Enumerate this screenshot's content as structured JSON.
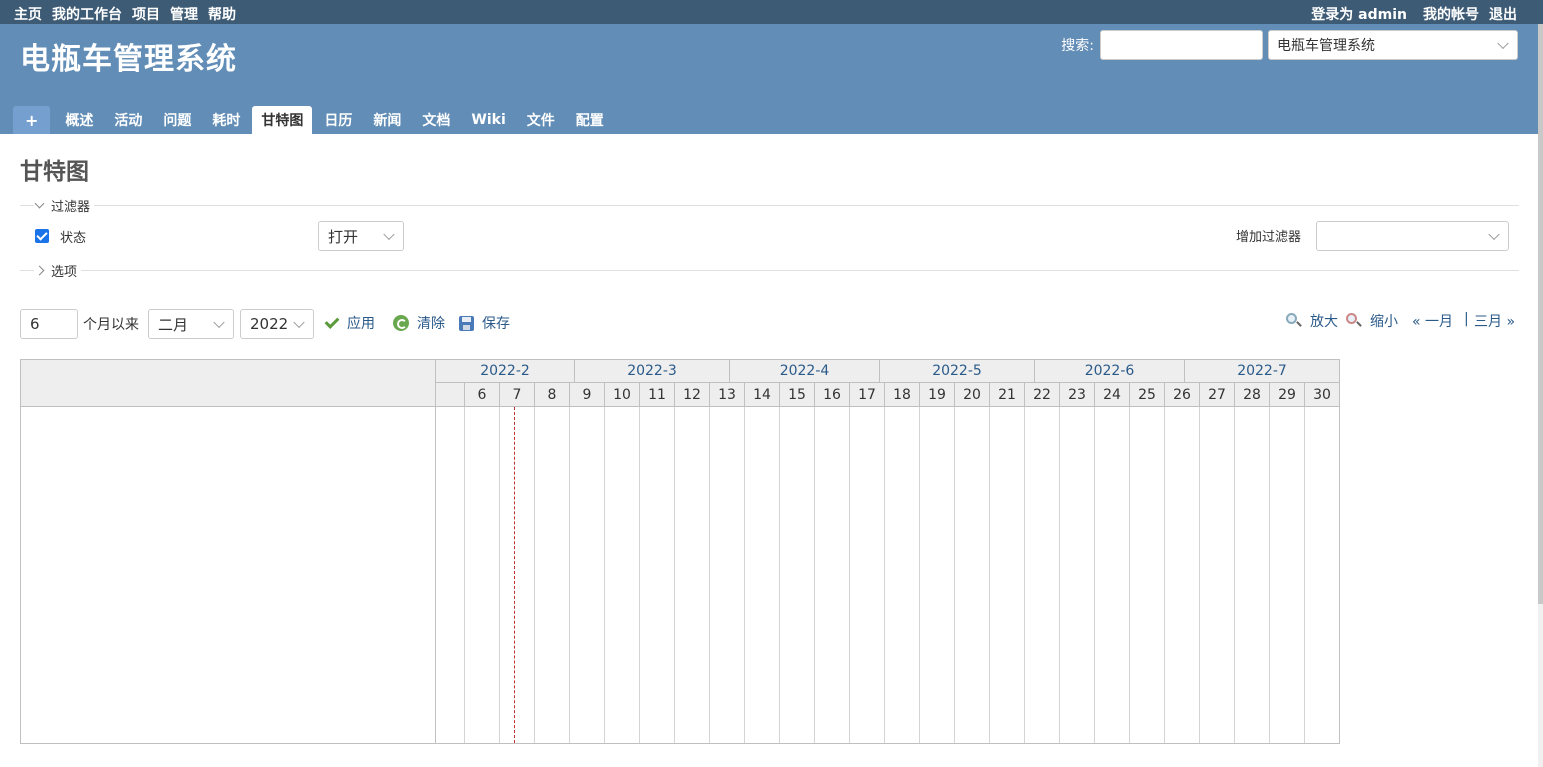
{
  "top_menu": {
    "items": [
      "主页",
      "我的工作台",
      "项目",
      "管理",
      "帮助"
    ],
    "login_prefix": "登录为",
    "login_user": "admin",
    "my_account": "我的帐号",
    "logout": "退出"
  },
  "header": {
    "title": "电瓶车管理系统",
    "search_label": "搜索:",
    "search_value": "",
    "project_select": "电瓶车管理系统"
  },
  "main_menu": {
    "new_label": "+",
    "tabs": [
      "概述",
      "活动",
      "问题",
      "耗时",
      "甘特图",
      "日历",
      "新闻",
      "文档",
      "Wiki",
      "文件",
      "配置"
    ],
    "selected": "甘特图"
  },
  "page": {
    "title": "甘特图",
    "filters_legend": "过滤器",
    "status_label": "状态",
    "status_operator": "打开",
    "add_filter_label": "增加过滤器",
    "add_filter_value": "",
    "options_legend": "选项"
  },
  "query": {
    "months": "6",
    "months_label": "个月以来",
    "month": "二月",
    "year": "2022",
    "apply": "应用",
    "clear": "清除",
    "save": "保存",
    "zoom_in": "放大",
    "zoom_out": "缩小",
    "prev": "« 一月",
    "separator": "|",
    "next": "三月 »"
  },
  "gantt": {
    "months": [
      {
        "label": "2022-2",
        "weeks": 4
      },
      {
        "label": "2022-3",
        "weeks": 4.5
      },
      {
        "label": "2022-4",
        "weeks": 4.3
      },
      {
        "label": "2022-5",
        "weeks": 4.4
      },
      {
        "label": "2022-6",
        "weeks": 4.3
      },
      {
        "label": "2022-7",
        "weeks": 4.4
      }
    ],
    "weeks": [
      "",
      "6",
      "7",
      "8",
      "9",
      "10",
      "11",
      "12",
      "13",
      "14",
      "15",
      "16",
      "17",
      "18",
      "19",
      "20",
      "21",
      "22",
      "23",
      "24",
      "25",
      "26",
      "27",
      "28",
      "29",
      "30"
    ],
    "today_week_index": 2
  }
}
